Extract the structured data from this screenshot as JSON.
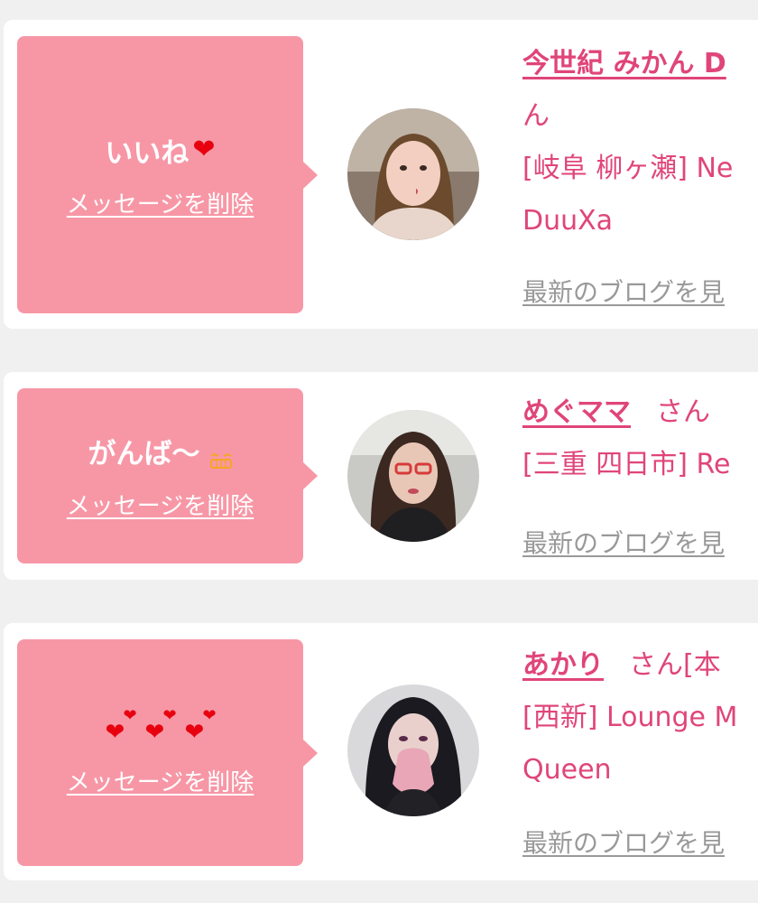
{
  "colors": {
    "bubble": "#f797a6",
    "accent": "#e0457a",
    "heart": "#e8000f",
    "muted": "#999999"
  },
  "delete_label": "メッセージを削除",
  "blog_label": "最新のブログを見",
  "cards": [
    {
      "message": "いいね",
      "message_icon": "red-heart-icon",
      "name": "今世紀 みかん D",
      "name_cont": "ん",
      "shop_lines": [
        "[岐阜 柳ヶ瀬] Ne",
        "DuuXa"
      ]
    },
    {
      "message": "がんば〜",
      "message_icon": "grimace-face-icon",
      "name": "めぐママ",
      "san": "さん",
      "shop_lines": [
        "[三重 四日市] Re"
      ]
    },
    {
      "message": "",
      "message_icon": "hearts-icon",
      "name": "あかり",
      "san": "さん[本",
      "shop_lines": [
        "[西新] Lounge M",
        "Queen"
      ]
    }
  ]
}
